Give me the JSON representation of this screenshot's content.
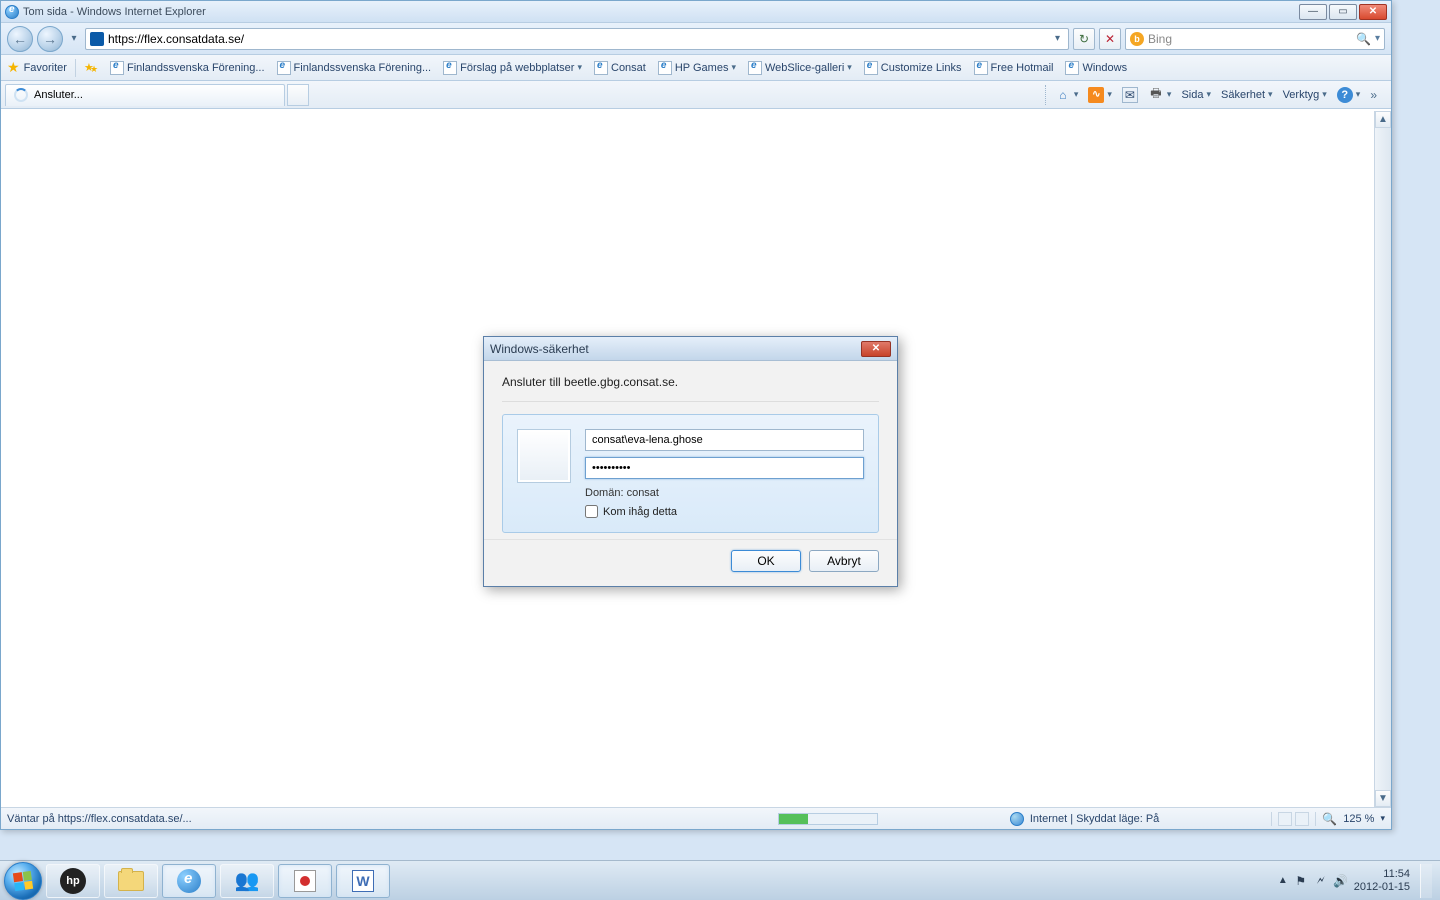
{
  "window": {
    "title": "Tom sida - Windows Internet Explorer"
  },
  "nav": {
    "url": "https://flex.consatdata.se/",
    "search_engine": "Bing",
    "search_placeholder": "Bing"
  },
  "favorites": {
    "label": "Favoriter",
    "bookmarks": [
      "Finlandssvenska Förening...",
      "Finlandssvenska Förening...",
      "Förslag på webbplatser",
      "Consat",
      "HP Games",
      "WebSlice-galleri",
      "Customize Links",
      "Free Hotmail",
      "Windows"
    ]
  },
  "tab": {
    "label": "Ansluter..."
  },
  "cmd": {
    "page": "Sida",
    "safety": "Säkerhet",
    "tools": "Verktyg"
  },
  "dialog": {
    "title": "Windows-säkerhet",
    "message": "Ansluter till beetle.gbg.consat.se.",
    "username": "consat\\eva-lena.ghose",
    "password_mask": "••••••••••",
    "domain_label": "Domän: consat",
    "remember": "Kom ihåg detta",
    "ok": "OK",
    "cancel": "Avbryt"
  },
  "status": {
    "text": "Väntar på https://flex.consatdata.se/...",
    "zone": "Internet | Skyddat läge: På",
    "zoom": "125 %"
  },
  "tray": {
    "time": "11:54",
    "date": "2012-01-15"
  }
}
